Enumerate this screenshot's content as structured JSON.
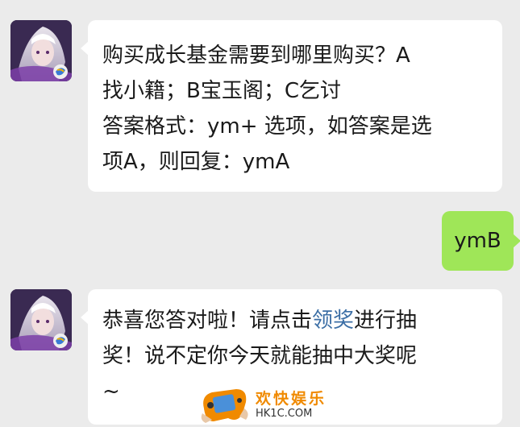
{
  "messages": [
    {
      "sender": "other",
      "lines": [
        "购买成长基金需要到哪里购买？A",
        "找小籍；B宝玉阁；C乞讨",
        "答案格式：ym+ 选项，如答案是选",
        "项A，则回复：ymA"
      ]
    },
    {
      "sender": "me",
      "text": "ymB"
    },
    {
      "sender": "other",
      "line1_before": "恭喜您答对啦！请点击",
      "line1_link": "领奖",
      "line1_after": "进行抽",
      "line2": "奖！说不定你今天就能抽中大奖呢",
      "line3": "~"
    }
  ],
  "watermark": {
    "name": "欢快娱乐",
    "url": "HK1C.COM"
  },
  "colors": {
    "background": "#ebebeb",
    "bubble_incoming": "#ffffff",
    "bubble_outgoing": "#9fe658",
    "link": "#3b6ea5",
    "watermark_text": "#f08a00"
  },
  "icons": [
    "avatar",
    "game-controller-icon"
  ]
}
